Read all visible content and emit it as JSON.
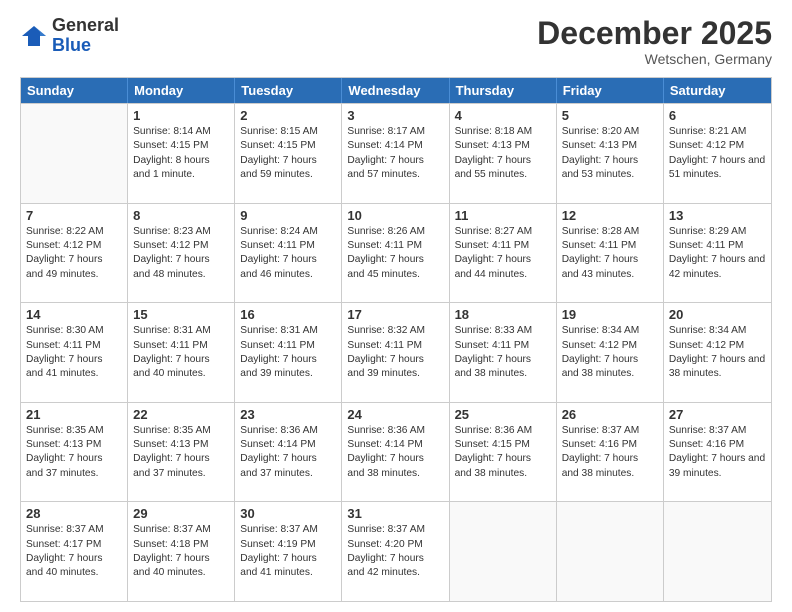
{
  "logo": {
    "general": "General",
    "blue": "Blue"
  },
  "header": {
    "month": "December 2025",
    "location": "Wetschen, Germany"
  },
  "days": [
    "Sunday",
    "Monday",
    "Tuesday",
    "Wednesday",
    "Thursday",
    "Friday",
    "Saturday"
  ],
  "weeks": [
    [
      {
        "day": "",
        "empty": true
      },
      {
        "day": "1",
        "sunrise": "8:14 AM",
        "sunset": "4:15 PM",
        "daylight": "8 hours and 1 minute."
      },
      {
        "day": "2",
        "sunrise": "8:15 AM",
        "sunset": "4:15 PM",
        "daylight": "7 hours and 59 minutes."
      },
      {
        "day": "3",
        "sunrise": "8:17 AM",
        "sunset": "4:14 PM",
        "daylight": "7 hours and 57 minutes."
      },
      {
        "day": "4",
        "sunrise": "8:18 AM",
        "sunset": "4:13 PM",
        "daylight": "7 hours and 55 minutes."
      },
      {
        "day": "5",
        "sunrise": "8:20 AM",
        "sunset": "4:13 PM",
        "daylight": "7 hours and 53 minutes."
      },
      {
        "day": "6",
        "sunrise": "8:21 AM",
        "sunset": "4:12 PM",
        "daylight": "7 hours and 51 minutes."
      }
    ],
    [
      {
        "day": "7",
        "sunrise": "8:22 AM",
        "sunset": "4:12 PM",
        "daylight": "7 hours and 49 minutes."
      },
      {
        "day": "8",
        "sunrise": "8:23 AM",
        "sunset": "4:12 PM",
        "daylight": "7 hours and 48 minutes."
      },
      {
        "day": "9",
        "sunrise": "8:24 AM",
        "sunset": "4:11 PM",
        "daylight": "7 hours and 46 minutes."
      },
      {
        "day": "10",
        "sunrise": "8:26 AM",
        "sunset": "4:11 PM",
        "daylight": "7 hours and 45 minutes."
      },
      {
        "day": "11",
        "sunrise": "8:27 AM",
        "sunset": "4:11 PM",
        "daylight": "7 hours and 44 minutes."
      },
      {
        "day": "12",
        "sunrise": "8:28 AM",
        "sunset": "4:11 PM",
        "daylight": "7 hours and 43 minutes."
      },
      {
        "day": "13",
        "sunrise": "8:29 AM",
        "sunset": "4:11 PM",
        "daylight": "7 hours and 42 minutes."
      }
    ],
    [
      {
        "day": "14",
        "sunrise": "8:30 AM",
        "sunset": "4:11 PM",
        "daylight": "7 hours and 41 minutes."
      },
      {
        "day": "15",
        "sunrise": "8:31 AM",
        "sunset": "4:11 PM",
        "daylight": "7 hours and 40 minutes."
      },
      {
        "day": "16",
        "sunrise": "8:31 AM",
        "sunset": "4:11 PM",
        "daylight": "7 hours and 39 minutes."
      },
      {
        "day": "17",
        "sunrise": "8:32 AM",
        "sunset": "4:11 PM",
        "daylight": "7 hours and 39 minutes."
      },
      {
        "day": "18",
        "sunrise": "8:33 AM",
        "sunset": "4:11 PM",
        "daylight": "7 hours and 38 minutes."
      },
      {
        "day": "19",
        "sunrise": "8:34 AM",
        "sunset": "4:12 PM",
        "daylight": "7 hours and 38 minutes."
      },
      {
        "day": "20",
        "sunrise": "8:34 AM",
        "sunset": "4:12 PM",
        "daylight": "7 hours and 38 minutes."
      }
    ],
    [
      {
        "day": "21",
        "sunrise": "8:35 AM",
        "sunset": "4:13 PM",
        "daylight": "7 hours and 37 minutes."
      },
      {
        "day": "22",
        "sunrise": "8:35 AM",
        "sunset": "4:13 PM",
        "daylight": "7 hours and 37 minutes."
      },
      {
        "day": "23",
        "sunrise": "8:36 AM",
        "sunset": "4:14 PM",
        "daylight": "7 hours and 37 minutes."
      },
      {
        "day": "24",
        "sunrise": "8:36 AM",
        "sunset": "4:14 PM",
        "daylight": "7 hours and 38 minutes."
      },
      {
        "day": "25",
        "sunrise": "8:36 AM",
        "sunset": "4:15 PM",
        "daylight": "7 hours and 38 minutes."
      },
      {
        "day": "26",
        "sunrise": "8:37 AM",
        "sunset": "4:16 PM",
        "daylight": "7 hours and 38 minutes."
      },
      {
        "day": "27",
        "sunrise": "8:37 AM",
        "sunset": "4:16 PM",
        "daylight": "7 hours and 39 minutes."
      }
    ],
    [
      {
        "day": "28",
        "sunrise": "8:37 AM",
        "sunset": "4:17 PM",
        "daylight": "7 hours and 40 minutes."
      },
      {
        "day": "29",
        "sunrise": "8:37 AM",
        "sunset": "4:18 PM",
        "daylight": "7 hours and 40 minutes."
      },
      {
        "day": "30",
        "sunrise": "8:37 AM",
        "sunset": "4:19 PM",
        "daylight": "7 hours and 41 minutes."
      },
      {
        "day": "31",
        "sunrise": "8:37 AM",
        "sunset": "4:20 PM",
        "daylight": "7 hours and 42 minutes."
      },
      {
        "day": "",
        "empty": true
      },
      {
        "day": "",
        "empty": true
      },
      {
        "day": "",
        "empty": true
      }
    ]
  ]
}
